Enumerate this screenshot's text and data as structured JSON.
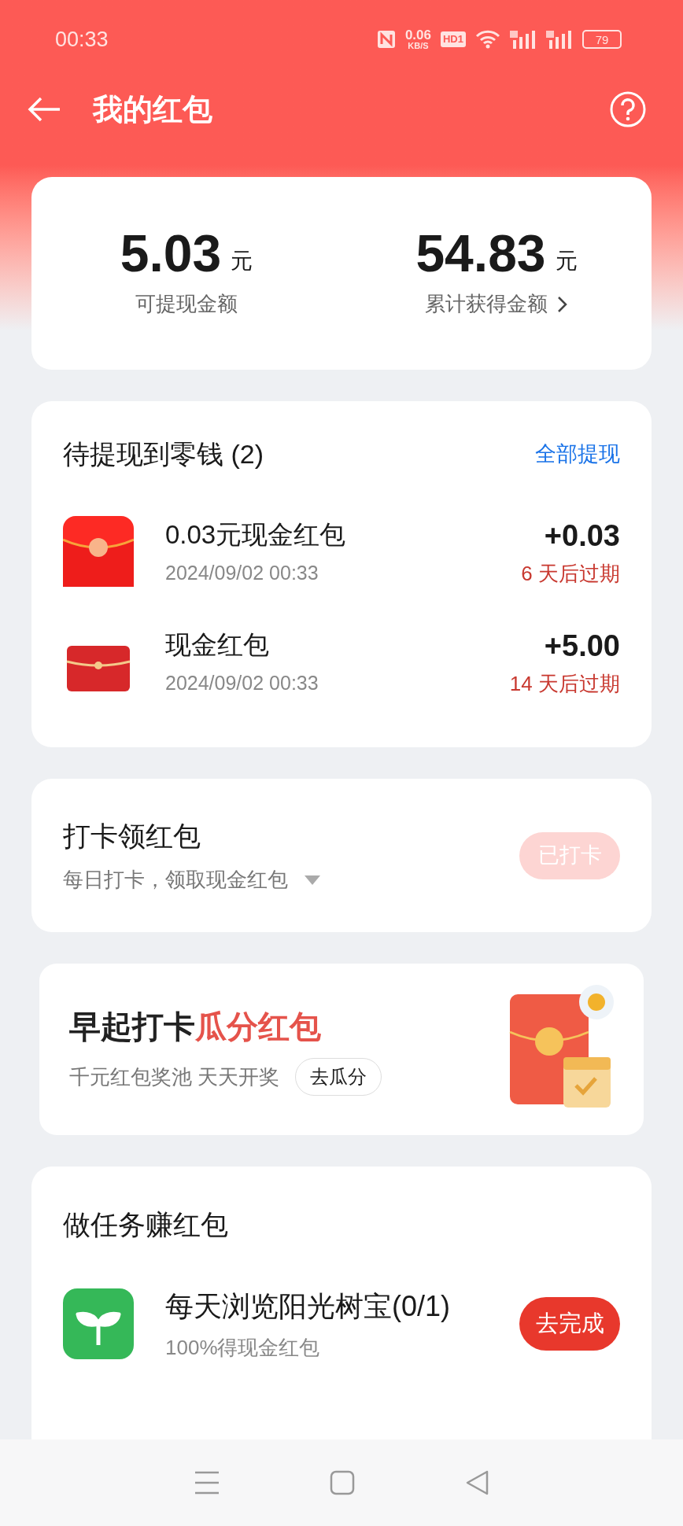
{
  "status_bar": {
    "time": "00:33",
    "speed_value": "0.06",
    "speed_unit": "KB/S",
    "hd_label": "HD1",
    "battery": "79"
  },
  "header": {
    "title": "我的红包"
  },
  "balances": [
    {
      "amount": "5.03",
      "unit": "元",
      "label": "可提现金额",
      "chevron": false
    },
    {
      "amount": "54.83",
      "unit": "元",
      "label": "累计获得金额",
      "chevron": true
    }
  ],
  "pending": {
    "title": "待提现到零钱 (2)",
    "action": "全部提现",
    "items": [
      {
        "kind": "square",
        "title": "0.03元现金红包",
        "date": "2024/09/02 00:33",
        "amount": "+0.03",
        "expiry": "6 天后过期"
      },
      {
        "kind": "envelope",
        "title": "现金红包",
        "date": "2024/09/02 00:33",
        "amount": "+5.00",
        "expiry": "14 天后过期"
      }
    ]
  },
  "checkin": {
    "title": "打卡领红包",
    "subtitle": "每日打卡，领取现金红包",
    "expanded": false,
    "button": {
      "label": "已打卡",
      "disabled": true
    }
  },
  "promo": {
    "title": "早起打卡",
    "title_accent": "瓜分红包",
    "subtitle": "千元红包奖池 天天开奖",
    "button": "去瓜分"
  },
  "tasks": {
    "title": "做任务赚红包",
    "items": [
      {
        "kind": "sprout",
        "title": "每天浏览阳光树宝(0/1)",
        "subtitle": "100%得现金红包",
        "button": "去完成"
      }
    ]
  }
}
